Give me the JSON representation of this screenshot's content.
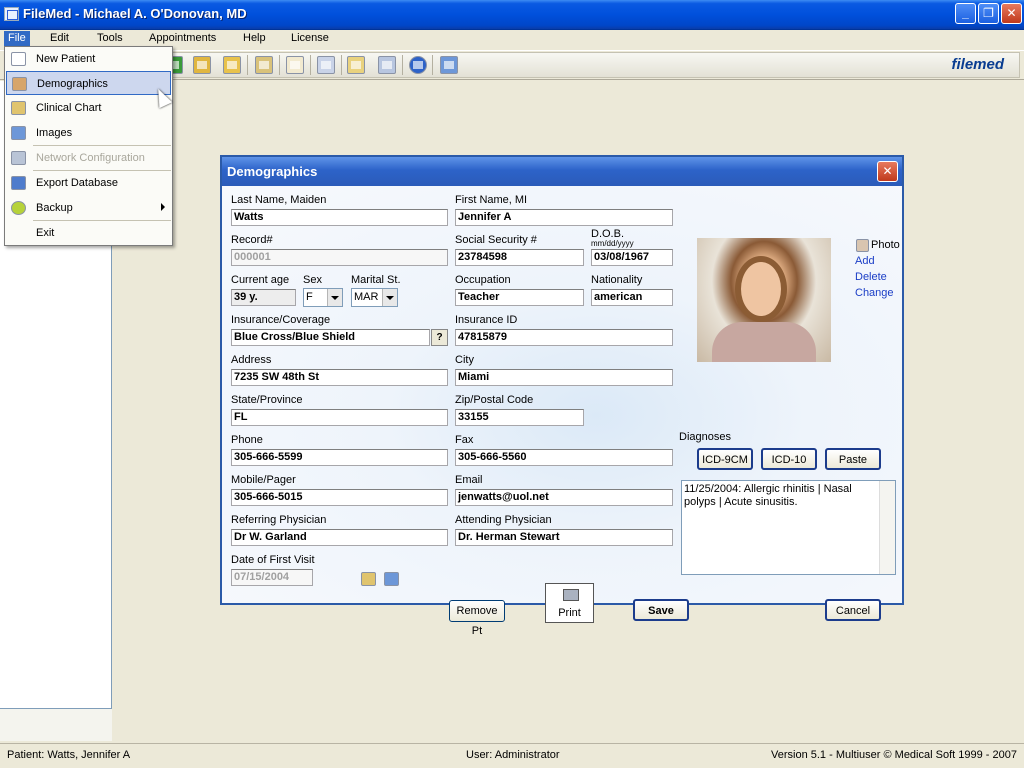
{
  "window": {
    "title": "FileMed - Michael A. O'Donovan, MD",
    "minimize": "_",
    "restore": "❐",
    "close": "✕"
  },
  "menubar": {
    "items": [
      "File",
      "Edit",
      "Tools",
      "Appointments",
      "Help",
      "License"
    ]
  },
  "toolbar": {
    "brand": "filemed",
    "icons": [
      "globe-icon",
      "folder-open-icon",
      "folder-icon",
      "edit-icon",
      "document-icon",
      "search-icon",
      "note-icon",
      "write-icon",
      "help-icon",
      "image-icon"
    ]
  },
  "file_menu": {
    "items": [
      {
        "label": "New Patient",
        "icon": "new-document-icon",
        "enabled": true
      },
      {
        "label": "Demographics",
        "icon": "person-icon",
        "enabled": true,
        "selected": true
      },
      {
        "label": "Clinical Chart",
        "icon": "chart-icon",
        "enabled": true
      },
      {
        "label": "Images",
        "icon": "image-icon",
        "enabled": true
      },
      {
        "label": "Network Configuration",
        "icon": "network-icon",
        "enabled": false
      },
      {
        "label": "Export Database",
        "icon": "export-icon",
        "enabled": true
      },
      {
        "label": "Backup",
        "icon": "backup-icon",
        "enabled": true,
        "submenu": true
      },
      {
        "label": "Exit",
        "icon": "",
        "enabled": true
      }
    ]
  },
  "dialog": {
    "title": "Demographics",
    "close": "✕",
    "fields": {
      "last_name": {
        "label": "Last Name, Maiden",
        "value": "Watts"
      },
      "first_name": {
        "label": "First Name, MI",
        "value": "Jennifer A"
      },
      "record": {
        "label": "Record#",
        "value": "000001"
      },
      "ssn": {
        "label": "Social Security #",
        "value": "23784598"
      },
      "dob": {
        "label": "D.O.B.",
        "format": "mm/dd/yyyy",
        "value": "03/08/1967"
      },
      "age": {
        "label": "Current age",
        "value": "39 y."
      },
      "sex": {
        "label": "Sex",
        "value": "F"
      },
      "marital": {
        "label": "Marital St.",
        "value": "MAR"
      },
      "occupation": {
        "label": "Occupation",
        "value": "Teacher"
      },
      "nationality": {
        "label": "Nationality",
        "value": "american"
      },
      "insurance": {
        "label": "Insurance/Coverage",
        "value": "Blue Cross/Blue Shield",
        "help": "?"
      },
      "insurance_id": {
        "label": "Insurance ID",
        "value": "47815879"
      },
      "address": {
        "label": "Address",
        "value": "7235 SW 48th St"
      },
      "city": {
        "label": "City",
        "value": "Miami"
      },
      "state": {
        "label": "State/Province",
        "value": "FL"
      },
      "zip": {
        "label": "Zip/Postal Code",
        "value": "33155"
      },
      "phone": {
        "label": "Phone",
        "value": "305-666-5599"
      },
      "fax": {
        "label": "Fax",
        "value": "305-666-5560"
      },
      "mobile": {
        "label": "Mobile/Pager",
        "value": "305-666-5015"
      },
      "email": {
        "label": "Email",
        "value": "jenwatts@uol.net"
      },
      "referring": {
        "label": "Referring Physician",
        "value": "Dr W. Garland"
      },
      "attending": {
        "label": "Attending Physician",
        "value": "Dr. Herman Stewart"
      },
      "first_visit": {
        "label": "Date of First Visit",
        "value": "07/15/2004"
      }
    },
    "photo": {
      "label": "Photo",
      "add": "Add",
      "delete": "Delete",
      "change": "Change"
    },
    "diagnoses": {
      "label": "Diagnoses",
      "buttons": [
        "ICD-9CM",
        "ICD-10",
        "Paste"
      ],
      "text": "11/25/2004: Allergic rhinitis | Nasal polyps | Acute sinusitis."
    },
    "buttons": {
      "remove": "Remove Pt",
      "print": "Print",
      "save": "Save",
      "cancel": "Cancel"
    }
  },
  "status": {
    "patient": "Patient: Watts, Jennifer A",
    "user": "User: Administrator",
    "version": "Version 5.1 - Multiuser  © Medical Soft 1999 - 2007"
  },
  "colors": {
    "titlebar": "#0054e3",
    "dialog_title": "#2d63c9",
    "link": "#1a3dc6",
    "selection": "#316ac5"
  }
}
